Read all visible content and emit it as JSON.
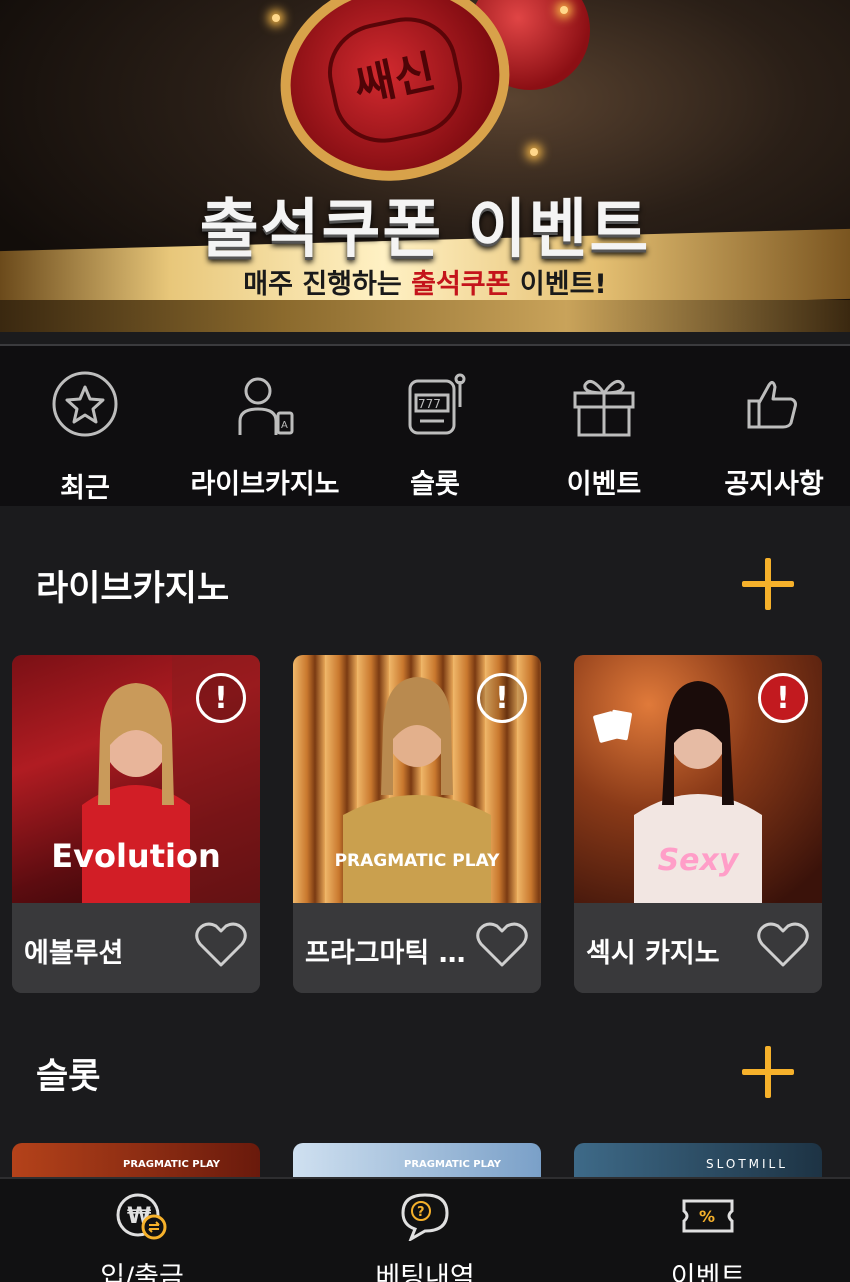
{
  "banner": {
    "title": "출석쿠폰 이벤트",
    "subtitle_prefix": "매주 진행하는 ",
    "subtitle_highlight": "출석쿠폰",
    "subtitle_suffix": " 이벤트!",
    "stamp_text": "쌔신"
  },
  "categories": [
    {
      "label": "최근",
      "icon": "star-icon"
    },
    {
      "label": "라이브카지노",
      "icon": "dealer-icon"
    },
    {
      "label": "슬롯",
      "icon": "slot-machine-icon"
    },
    {
      "label": "이벤트",
      "icon": "gift-icon"
    },
    {
      "label": "공지사항",
      "icon": "thumbs-up-icon"
    }
  ],
  "live_casino": {
    "title": "라이브카지노",
    "cards": [
      {
        "name": "에볼루션",
        "logo": "Evolution"
      },
      {
        "name": "프라그마틱 …",
        "logo": "PRAGMATIC PLAY"
      },
      {
        "name": "섹시 카지노",
        "logo": "Sexy"
      }
    ]
  },
  "slots": {
    "title": "슬롯",
    "cards": [
      {
        "logo": "PRAGMATIC PLAY"
      },
      {
        "logo": "PRAGMATIC PLAY"
      },
      {
        "logo": "SLOTMILL"
      }
    ]
  },
  "bottom_nav": [
    {
      "label": "입/출금",
      "icon": "won-exchange-icon"
    },
    {
      "label": "베팅내역",
      "icon": "question-bubble-icon"
    },
    {
      "label": "이벤트",
      "icon": "percent-ticket-icon"
    }
  ],
  "colors": {
    "accent": "#f6b12b",
    "background": "#1b1b1d",
    "card": "#39393b"
  }
}
